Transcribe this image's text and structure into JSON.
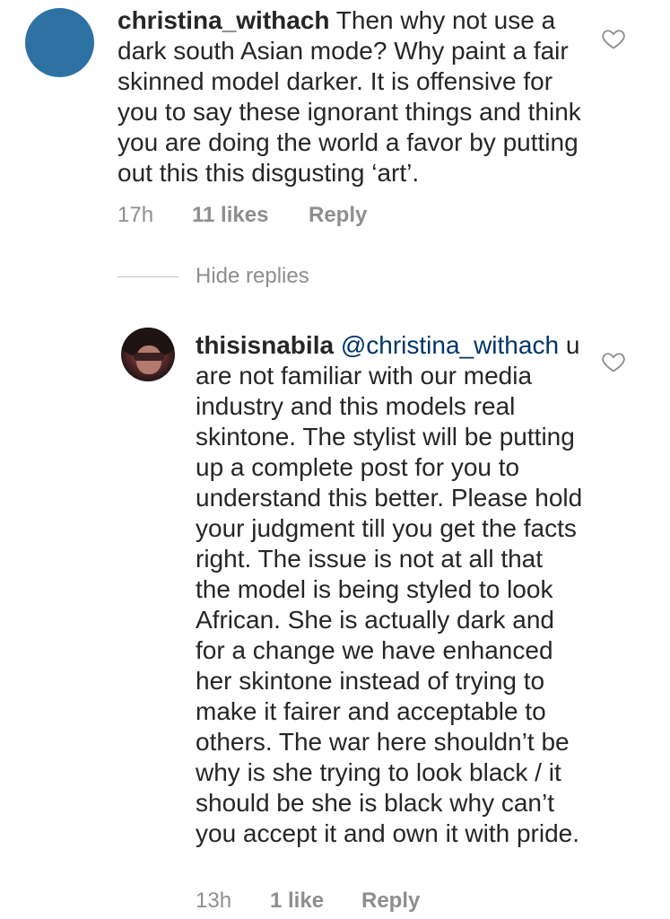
{
  "comments": [
    {
      "username": "christina_withach",
      "text": "Then why not use a dark south Asian mode? Why paint a fair skinned model darker. It is offensive for you to say these ignorant things and think you are doing the world a favor by putting out this this disgusting ‘art’.",
      "time": "17h",
      "likes": "11 likes",
      "reply_label": "Reply",
      "avatar_color": "#2e72a3"
    }
  ],
  "hide_replies_label": "Hide replies",
  "replies": [
    {
      "username": "thisisnabila",
      "mention": "@christina_withach",
      "text": "u are not familiar with our media industry and this models real skintone. The stylist will be putting up a complete post for you to understand this better. Please hold your judgment till you get the facts right. The issue is not at all that the model is being styled to look African. She is actually dark and for a change we have enhanced her skintone instead of trying to make it fairer and acceptable to others. The war here shouldn’t be why is she trying to look black / it should be she is black why can’t you accept it and own it with pride.",
      "time": "13h",
      "likes": "1 like",
      "reply_label": "Reply"
    }
  ],
  "icons": {
    "like": "heart-outline-icon"
  },
  "colors": {
    "text": "#262626",
    "meta": "#8e8e8e",
    "mention": "#003569",
    "divider": "#c7c7c7"
  }
}
